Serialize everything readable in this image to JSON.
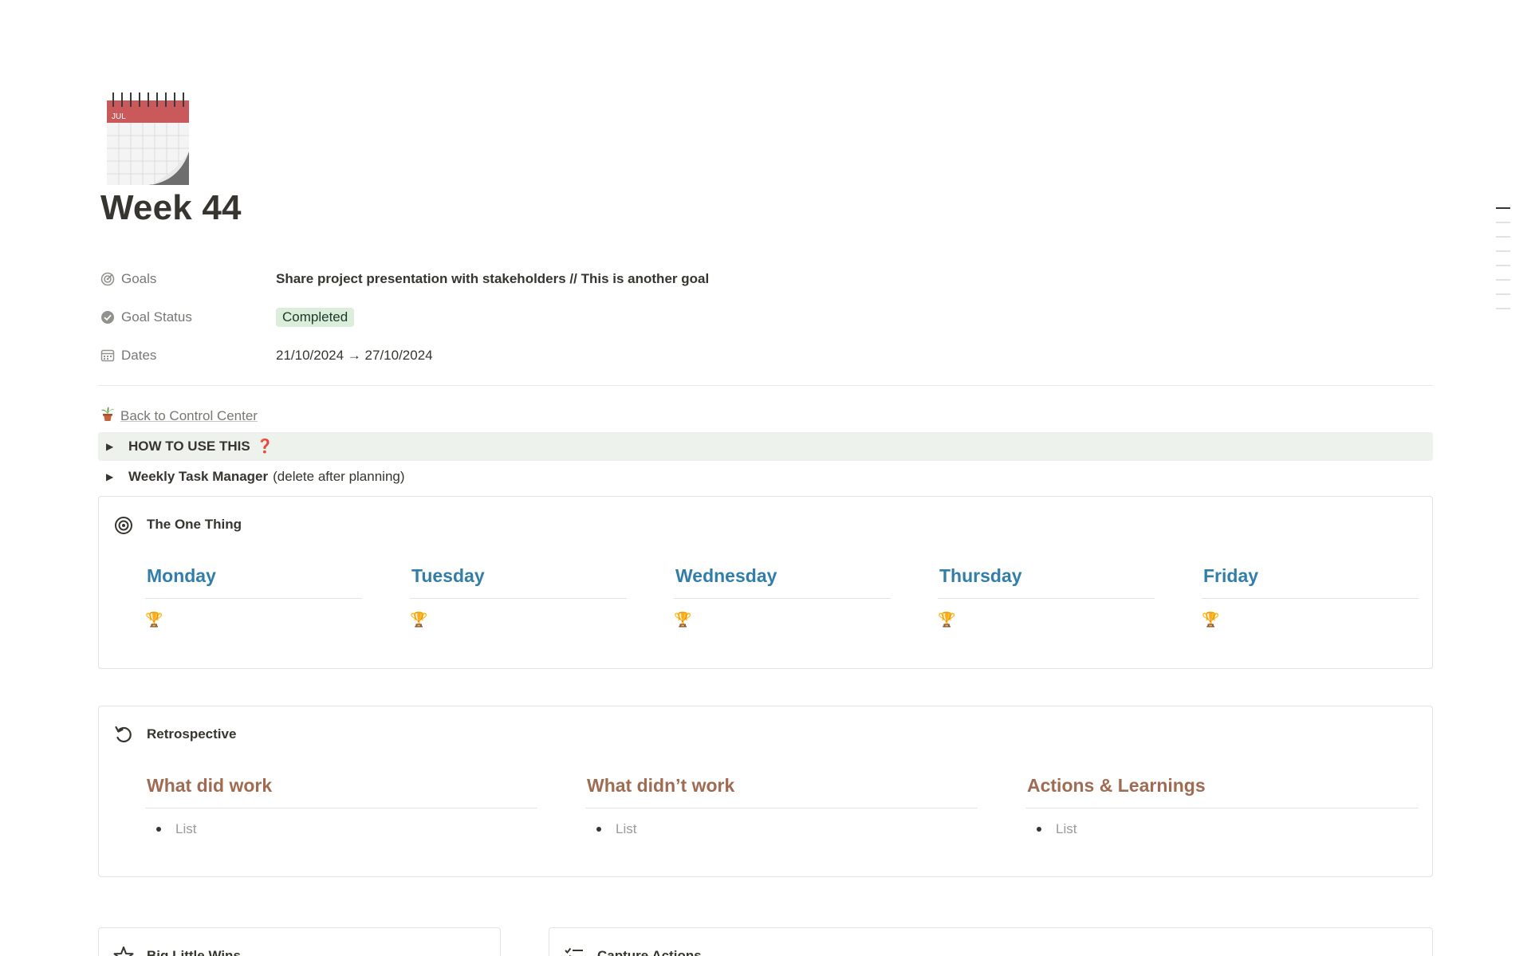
{
  "page": {
    "title": "Week 44",
    "icon": "calendar-icon",
    "icon_month": "JUL"
  },
  "properties": {
    "goals": {
      "label": "Goals",
      "icon": "target-icon",
      "value": "Share project presentation with stakeholders // This is another goal"
    },
    "goal_status": {
      "label": "Goal Status",
      "icon": "check-circle-icon",
      "value": "Completed",
      "color": "#dbeddb"
    },
    "dates": {
      "label": "Dates",
      "icon": "calendar-small-icon",
      "value": "21/10/2024 → 27/10/2024"
    }
  },
  "back_link": {
    "icon": "plant-pot-icon",
    "label": "Back to Control Center"
  },
  "toggles": {
    "how_to": {
      "label": "HOW TO USE THIS",
      "suffix": "❓",
      "bg": "#edf3ec"
    },
    "weekly": {
      "label": "Weekly Task Manager",
      "note": "(delete after planning)"
    }
  },
  "one_thing": {
    "title": "The One Thing",
    "icon": "bullseye-icon",
    "days": [
      {
        "label": "Monday",
        "icon": "trophy-icon"
      },
      {
        "label": "Tuesday",
        "icon": "trophy-icon"
      },
      {
        "label": "Wednesday",
        "icon": "trophy-icon"
      },
      {
        "label": "Thursday",
        "icon": "trophy-icon"
      },
      {
        "label": "Friday",
        "icon": "trophy-icon"
      }
    ],
    "accent": "#337ea9"
  },
  "retrospective": {
    "title": "Retrospective",
    "icon": "rotate-ccw-icon",
    "columns": [
      {
        "label": "What did work",
        "item": "List"
      },
      {
        "label": "What didn’t work",
        "item": "List"
      },
      {
        "label": "Actions & Learnings",
        "item": "List"
      }
    ],
    "accent": "#9f6b53"
  },
  "bottom_cards": {
    "wins": {
      "title": "Big Little Wins",
      "icon": "star-icon"
    },
    "actions": {
      "title": "Capture Actions",
      "icon": "checklist-icon"
    }
  }
}
